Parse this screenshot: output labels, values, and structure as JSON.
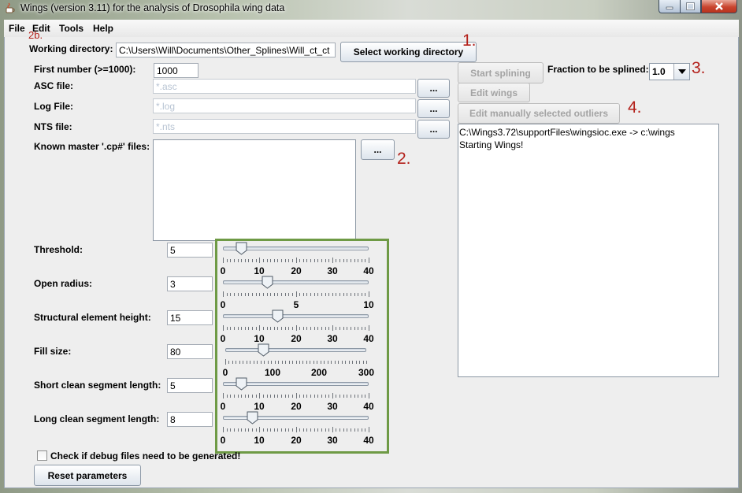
{
  "window": {
    "title": "Wings (version 3.11) for the analysis of Drosophila wing data"
  },
  "menu": [
    {
      "label": "File"
    },
    {
      "label": "Edit"
    },
    {
      "label": "Tools"
    },
    {
      "label": "Help"
    }
  ],
  "annotations": {
    "a1": "1.",
    "a2": "2.",
    "a2b": "2b.",
    "a3": "3.",
    "a4": "4."
  },
  "form": {
    "working_dir_label": "Working directory:",
    "working_dir_value": "C:\\Users\\Will\\Documents\\Other_Splines\\Will_ct_ct",
    "select_dir_button": "Select working directory",
    "first_number_label": "First number (>=1000):",
    "first_number_value": "1000",
    "asc_label": "ASC file:",
    "asc_value": "*.asc",
    "log_label": "Log File:",
    "log_value": "*.log",
    "nts_label": "NTS file:",
    "nts_value": "*.nts",
    "browse_button": "...",
    "known_master_label": "Known master '.cp#' files:"
  },
  "right": {
    "start_splining": "Start splining",
    "edit_wings": "Edit wings",
    "edit_outliers": "Edit manually selected outliers",
    "fraction_label": "Fraction to be splined:",
    "fraction_value": "1.0",
    "log_lines": [
      "C:\\Wings3.72\\supportFiles\\wingsioc.exe -> c:\\wings",
      "Starting Wings!"
    ]
  },
  "sliders": [
    {
      "label": "Threshold:",
      "value": "5",
      "min": 0,
      "max": 40,
      "ticks": [
        "0",
        "10",
        "20",
        "30",
        "40"
      ],
      "level": 5
    },
    {
      "label": "Open radius:",
      "value": "3",
      "min": 0,
      "max": 10,
      "ticks": [
        "0",
        "5",
        "10"
      ],
      "level": 3
    },
    {
      "label": "Structural element height:",
      "value": "15",
      "min": 0,
      "max": 40,
      "ticks": [
        "0",
        "10",
        "20",
        "30",
        "40"
      ],
      "level": 15
    },
    {
      "label": "Fill size:",
      "value": "80",
      "min": 0,
      "max": 300,
      "ticks": [
        "0",
        "100",
        "200",
        "300"
      ],
      "level": 80
    },
    {
      "label": "Short clean segment length:",
      "value": "5",
      "min": 0,
      "max": 40,
      "ticks": [
        "0",
        "10",
        "20",
        "30",
        "40"
      ],
      "level": 5
    },
    {
      "label": "Long clean segment length:",
      "value": "8",
      "min": 0,
      "max": 40,
      "ticks": [
        "0",
        "10",
        "20",
        "30",
        "40"
      ],
      "level": 8
    }
  ],
  "debug_label": "Check if debug files need to be generated!",
  "reset_button": "Reset parameters",
  "colors": {
    "annotation": "#b3201a",
    "slider_group_border": "#6e9a45"
  }
}
